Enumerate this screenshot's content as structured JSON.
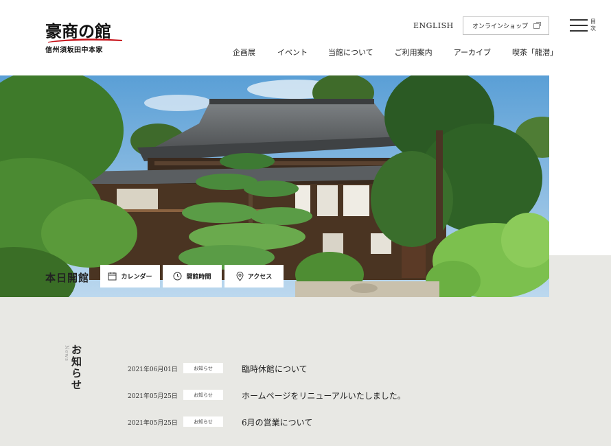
{
  "header": {
    "logo_main": "豪商の館",
    "logo_sub": "信州須坂田中本家",
    "lang_link": "ENGLISH",
    "shop_button": "オンラインショップ",
    "menu_label": "目次",
    "nav": [
      "企画展",
      "イベント",
      "当館について",
      "ご利用案内",
      "アーカイブ",
      "喫茶「龍潜」"
    ]
  },
  "status": {
    "title": "本日開館",
    "buttons": [
      {
        "label": "カレンダー",
        "icon": "calendar-icon"
      },
      {
        "label": "開館時間",
        "icon": "clock-icon"
      },
      {
        "label": "アクセス",
        "icon": "map-pin-icon"
      }
    ]
  },
  "news": {
    "heading": "お知らせ",
    "heading_en": "News",
    "items": [
      {
        "date": "2021年06月01日",
        "tag": "お知らせ",
        "title": "臨時休館について"
      },
      {
        "date": "2021年05月25日",
        "tag": "お知らせ",
        "title": "ホームページをリニューアルいたしました。"
      },
      {
        "date": "2021年05月25日",
        "tag": "お知らせ",
        "title": "6月の営業について"
      }
    ]
  },
  "colors": {
    "accent": "#c8161d",
    "grey_band": "#e8e8e4"
  }
}
